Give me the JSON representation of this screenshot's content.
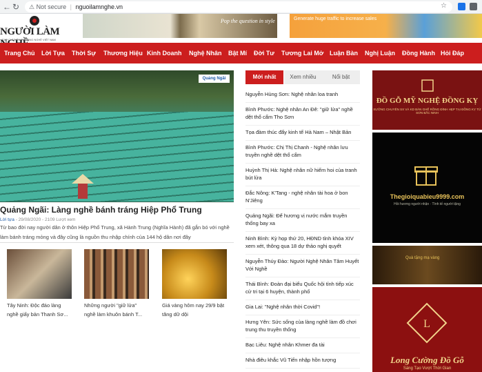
{
  "browser": {
    "security_label": "Not secure",
    "url": "nguoilamnghe.vn"
  },
  "header": {
    "logo_text": "NGƯỜI LÀM NGHỀ",
    "logo_sub": "TẠP CHÍ ĐIỆN TỬ LÀNG NGHỀ VIỆT NAM",
    "banner1_text": "Pop the question in style",
    "banner2_text": "Generate huge traffic to increase sales"
  },
  "menu": [
    "Trang Chủ",
    "Lời Tựa",
    "Thời Sự",
    "Thương Hiệu",
    "Kinh Doanh",
    "Nghệ Nhân",
    "Bật Mí",
    "Đời Tư",
    "Tương Lai Mở",
    "Luận Bàn",
    "Nghị Luận",
    "Đồng Hành",
    "Hỏi Đáp"
  ],
  "feature": {
    "source_tag": "Quảng Ngãi",
    "title": "Quảng Ngãi: Làng nghề bánh tráng Hiệp Phổ Trung",
    "author": "Lời tựa",
    "meta": " - 29/08/2020 - 2109 Lượt xem",
    "description": "Từ bao đời nay người dân ở thôn Hiệp Phổ Trung, xã Hành Trung (Nghĩa Hành) đã gắn bó với nghề làm bánh tráng mỏng và đây cũng là nguồn thu nhập chính của 144 hộ dân nơi đây"
  },
  "thumbs": [
    {
      "caption": "Tây Ninh: Độc đáo làng nghề giấy bản Thanh Sơ..."
    },
    {
      "caption": "Những người \"giữ lửa\" nghề làm khuôn bánh T..."
    },
    {
      "caption": "Giá vàng hôm nay 29/9 bật tăng dữ dội"
    }
  ],
  "tabs": [
    "Mới nhất",
    "Xem nhiều",
    "Nổi bật"
  ],
  "news": [
    "Nguyễn Hùng Sơn: Nghệ nhân loa tranh",
    "Bình Phước: Nghệ nhân An Đê: \"giữ lửa\" nghề dệt thổ cẩm Tho Sơn",
    "Tọa đàm thúc đẩy kinh tế Hà Nam – Nhật Bản",
    "Bình Phước: Chị Thị Chanh - Nghệ nhân lưu truyền nghề dệt thổ cẩm",
    "Huỳnh Thị Hà: Nghệ nhân nữ hiếm hoi của tranh bút lửa",
    "Đắc Nông: K'Tang - nghệ nhân tài hoa ở bon N'Jiêng",
    "Quảng Ngãi: Để hương vị nước mắm truyền thống bay xa",
    "Ninh Bình: Kỳ họp thứ 20, HĐND tỉnh khóa XIV xem xét, thông qua 18 dự thảo nghị quyết",
    "Nguyễn Thúy Đào: Người Nghệ Nhân Tâm Huyết Với Nghề",
    "Thái Bình: Đoàn đại biểu Quốc hội tỉnh tiếp xúc cử tri tại 6 huyện, thành phố",
    "Gia Lai: \"Nghệ nhân thời Covid\"!",
    "Hưng Yên: Sức sống của làng nghề làm đồ chơi trung thu truyền thống",
    "Bạc Liêu: Nghệ nhân Khmer đa tài",
    "Nhà điêu khắc Vũ Tiến nhập hồn tượng"
  ],
  "ads": {
    "ad1_title": "ĐỒ GỖ MỸ NGHỆ ĐỒNG KỴ",
    "ad1_sub": "XƯỞNG CHUYÊN SX VÀ KD BÀN GHẾ RỒNG ĐÌNH HẸP TẠI ĐỒNG KỴ TỪ SƠN BẮC NINH",
    "ad2_title": "Thegioiquabieu9999.com",
    "ad2_sub": "Hồi hương người nhận · Tình tế người tặng",
    "ad3_text": "Quà tặng mạ vàng",
    "ad4_title": "Long Cường Đồ Gỗ",
    "ad4_sub": "Sáng Tạo Vượt Thời Gian"
  },
  "colors": {
    "brand_red": "#cc1e1e",
    "link_blue": "#1c5aa6"
  }
}
